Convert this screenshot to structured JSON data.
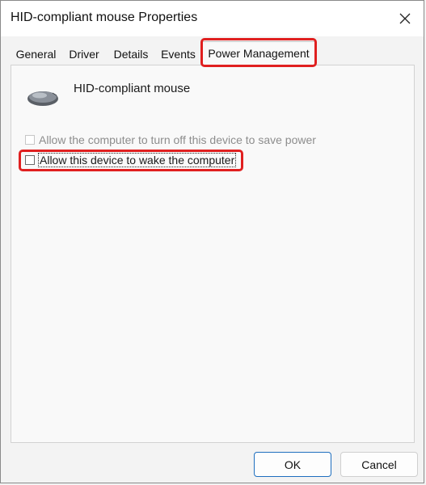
{
  "window": {
    "title": "HID-compliant mouse Properties"
  },
  "tabs": [
    {
      "label": "General"
    },
    {
      "label": "Driver"
    },
    {
      "label": "Details"
    },
    {
      "label": "Events"
    },
    {
      "label": "Power Management",
      "selected": true
    }
  ],
  "device": {
    "name": "HID-compliant mouse",
    "icon": "mouse-icon"
  },
  "options": [
    {
      "label": "Allow the computer to turn off this device to save power",
      "checked": false,
      "enabled": false
    },
    {
      "label": "Allow this device to wake the computer",
      "checked": false,
      "enabled": true
    }
  ],
  "buttons": {
    "ok": "OK",
    "cancel": "Cancel"
  },
  "colors": {
    "highlight": "#e02020",
    "default_button_border": "#1f6fbf"
  }
}
